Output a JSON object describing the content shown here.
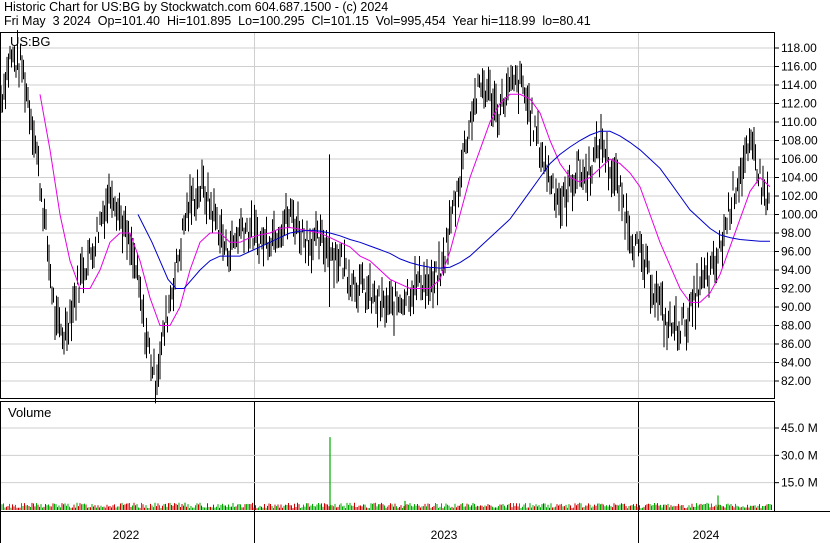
{
  "header": {
    "line1": "Historic Chart for US:BG by Stockwatch.com 604.687.1500 - (c) 2024",
    "line2": "Fri May  3 2024  Op=101.40  Hi=101.895  Lo=100.295  Cl=101.15  Vol=995,454  Year hi=118.99  lo=80.41"
  },
  "colors": {
    "price_bars": "#000000",
    "ma_short": "#e600e6",
    "ma_long": "#0000cc",
    "volume_up": "#00aa00",
    "volume_down": "#cc0000"
  },
  "chart_data": [
    {
      "type": "line",
      "title": "US:BG",
      "description_of_series": "daily OHLC high-low bars with two moving averages",
      "ylim": [
        79.5,
        119.5
      ],
      "y_ticks": [
        "118.00",
        "116.00",
        "114.00",
        "112.00",
        "110.00",
        "108.00",
        "106.00",
        "104.00",
        "102.00",
        "100.00",
        "98.00",
        "96.00",
        "94.00",
        "92.00",
        "90.00",
        "88.00",
        "86.00",
        "84.00",
        "82.00"
      ],
      "x_labels": [
        "2022",
        "2023",
        "2024"
      ],
      "series": [
        {
          "style": "black high-low bars",
          "points": [
            [
              0,
              112
            ],
            [
              10,
              117
            ],
            [
              22,
              116
            ],
            [
              34,
              109
            ],
            [
              44,
              100
            ],
            [
              50,
              94
            ],
            [
              56,
              88
            ],
            [
              64,
              87
            ],
            [
              72,
              90
            ],
            [
              82,
              94
            ],
            [
              92,
              96
            ],
            [
              102,
              100
            ],
            [
              112,
              103
            ],
            [
              120,
              100
            ],
            [
              128,
              97
            ],
            [
              136,
              94
            ],
            [
              144,
              88
            ],
            [
              150,
              85
            ],
            [
              155,
              82
            ],
            [
              162,
              86
            ],
            [
              170,
              91
            ],
            [
              178,
              95
            ],
            [
              186,
              100
            ],
            [
              194,
              102
            ],
            [
              202,
              103
            ],
            [
              210,
              101
            ],
            [
              218,
              99
            ],
            [
              226,
              96
            ],
            [
              234,
              97
            ],
            [
              242,
              99
            ],
            [
              252,
              98
            ],
            [
              262,
              97
            ],
            [
              272,
              98
            ],
            [
              282,
              99
            ],
            [
              292,
              100
            ],
            [
              302,
              98
            ],
            [
              312,
              97
            ],
            [
              322,
              97
            ],
            [
              332,
              96
            ],
            [
              342,
              95
            ],
            [
              352,
              93
            ],
            [
              362,
              92
            ],
            [
              372,
              91
            ],
            [
              382,
              90
            ],
            [
              392,
              90
            ],
            [
              402,
              91
            ],
            [
              412,
              92
            ],
            [
              422,
              93
            ],
            [
              432,
              92
            ],
            [
              442,
              94
            ],
            [
              450,
              99
            ],
            [
              458,
              103
            ],
            [
              466,
              108
            ],
            [
              474,
              112
            ],
            [
              482,
              114
            ],
            [
              490,
              113
            ],
            [
              498,
              111
            ],
            [
              506,
              113
            ],
            [
              514,
              114
            ],
            [
              522,
              114
            ],
            [
              530,
              111
            ],
            [
              538,
              108
            ],
            [
              546,
              105
            ],
            [
              554,
              103
            ],
            [
              562,
              101
            ],
            [
              570,
              103
            ],
            [
              578,
              105
            ],
            [
              586,
              104
            ],
            [
              594,
              106
            ],
            [
              602,
              108
            ],
            [
              610,
              105
            ],
            [
              618,
              103
            ],
            [
              626,
              100
            ],
            [
              634,
              97
            ],
            [
              642,
              95
            ],
            [
              650,
              93
            ],
            [
              658,
              91
            ],
            [
              666,
              88
            ],
            [
              674,
              88
            ],
            [
              682,
              88
            ],
            [
              690,
              89
            ],
            [
              698,
              92
            ],
            [
              706,
              93
            ],
            [
              714,
              94
            ],
            [
              722,
              97
            ],
            [
              730,
              101
            ],
            [
              738,
              104
            ],
            [
              746,
              106
            ],
            [
              754,
              107
            ],
            [
              762,
              103
            ],
            [
              770,
              101
            ]
          ]
        },
        {
          "style": "magenta moving average",
          "points": [
            [
              40,
              113
            ],
            [
              50,
              107
            ],
            [
              60,
              100
            ],
            [
              70,
              95
            ],
            [
              80,
              92
            ],
            [
              90,
              92
            ],
            [
              100,
              94
            ],
            [
              110,
              97
            ],
            [
              120,
              98
            ],
            [
              130,
              98
            ],
            [
              140,
              95
            ],
            [
              150,
              91
            ],
            [
              160,
              88
            ],
            [
              170,
              88
            ],
            [
              180,
              90
            ],
            [
              190,
              94
            ],
            [
              200,
              97
            ],
            [
              210,
              98
            ],
            [
              220,
              98
            ],
            [
              230,
              97
            ],
            [
              240,
              97
            ],
            [
              250,
              97.5
            ],
            [
              260,
              97.8
            ],
            [
              270,
              98
            ],
            [
              280,
              98.5
            ],
            [
              290,
              98.6
            ],
            [
              300,
              98.4
            ],
            [
              310,
              98.2
            ],
            [
              320,
              98
            ],
            [
              330,
              97.5
            ],
            [
              340,
              97
            ],
            [
              350,
              96.5
            ],
            [
              360,
              95.5
            ],
            [
              370,
              95
            ],
            [
              380,
              94
            ],
            [
              390,
              93
            ],
            [
              400,
              92.5
            ],
            [
              410,
              92
            ],
            [
              420,
              92
            ],
            [
              430,
              92
            ],
            [
              440,
              93
            ],
            [
              450,
              96
            ],
            [
              460,
              100
            ],
            [
              470,
              104
            ],
            [
              480,
              107
            ],
            [
              490,
              110
            ],
            [
              500,
              112
            ],
            [
              510,
              113
            ],
            [
              520,
              113
            ],
            [
              530,
              112.5
            ],
            [
              540,
              111
            ],
            [
              550,
              108
            ],
            [
              560,
              105.5
            ],
            [
              570,
              104
            ],
            [
              580,
              103.5
            ],
            [
              590,
              104
            ],
            [
              600,
              105
            ],
            [
              610,
              106
            ],
            [
              620,
              105.5
            ],
            [
              630,
              104.5
            ],
            [
              640,
              103
            ],
            [
              650,
              100
            ],
            [
              660,
              97
            ],
            [
              670,
              94.5
            ],
            [
              680,
              92
            ],
            [
              690,
              90.5
            ],
            [
              700,
              90.5
            ],
            [
              710,
              91.5
            ],
            [
              720,
              93.5
            ],
            [
              730,
              96.5
            ],
            [
              740,
              99.5
            ],
            [
              750,
              102.5
            ],
            [
              760,
              104
            ],
            [
              770,
              103
            ]
          ]
        },
        {
          "style": "blue moving average",
          "points": [
            [
              138,
              100
            ],
            [
              145,
              98.5
            ],
            [
              152,
              97
            ],
            [
              160,
              95
            ],
            [
              168,
              93
            ],
            [
              176,
              92
            ],
            [
              184,
              92
            ],
            [
              192,
              93
            ],
            [
              200,
              94
            ],
            [
              210,
              95
            ],
            [
              220,
              95.5
            ],
            [
              230,
              95.5
            ],
            [
              240,
              95.5
            ],
            [
              250,
              96
            ],
            [
              260,
              96.5
            ],
            [
              270,
              97
            ],
            [
              280,
              97.5
            ],
            [
              290,
              98
            ],
            [
              300,
              98.2
            ],
            [
              310,
              98.3
            ],
            [
              320,
              98.2
            ],
            [
              330,
              98
            ],
            [
              340,
              97.7
            ],
            [
              350,
              97.3
            ],
            [
              360,
              97
            ],
            [
              370,
              96.6
            ],
            [
              380,
              96.2
            ],
            [
              390,
              95.8
            ],
            [
              400,
              95.2
            ],
            [
              410,
              94.8
            ],
            [
              420,
              94.5
            ],
            [
              430,
              94.3
            ],
            [
              440,
              94.2
            ],
            [
              450,
              94.3
            ],
            [
              460,
              94.8
            ],
            [
              470,
              95.5
            ],
            [
              480,
              96.5
            ],
            [
              490,
              97.5
            ],
            [
              500,
              98.5
            ],
            [
              510,
              99.5
            ],
            [
              520,
              101
            ],
            [
              530,
              102.5
            ],
            [
              540,
              104
            ],
            [
              550,
              105.5
            ],
            [
              560,
              106.5
            ],
            [
              570,
              107.3
            ],
            [
              580,
              108
            ],
            [
              590,
              108.6
            ],
            [
              600,
              109
            ],
            [
              610,
              109
            ],
            [
              620,
              108.5
            ],
            [
              630,
              107.8
            ],
            [
              640,
              107
            ],
            [
              650,
              106
            ],
            [
              660,
              105
            ],
            [
              670,
              103.5
            ],
            [
              680,
              102
            ],
            [
              690,
              100.5
            ],
            [
              700,
              99.5
            ],
            [
              710,
              98.5
            ],
            [
              720,
              97.8
            ],
            [
              730,
              97.5
            ],
            [
              740,
              97.3
            ],
            [
              750,
              97.2
            ],
            [
              760,
              97.1
            ],
            [
              770,
              97.1
            ]
          ]
        }
      ]
    },
    {
      "type": "bar",
      "title": "Volume",
      "ylim": [
        0,
        60
      ],
      "y_ticks": [
        "45.0 M",
        "30.0 M",
        "15.0 M"
      ],
      "spikes": [
        {
          "x": 330,
          "value": 40
        },
        {
          "x": 718,
          "value": 8
        },
        {
          "x": 405,
          "value": 5
        },
        {
          "x": 185,
          "value": 4
        }
      ],
      "baseline_range": [
        1,
        4
      ]
    }
  ]
}
